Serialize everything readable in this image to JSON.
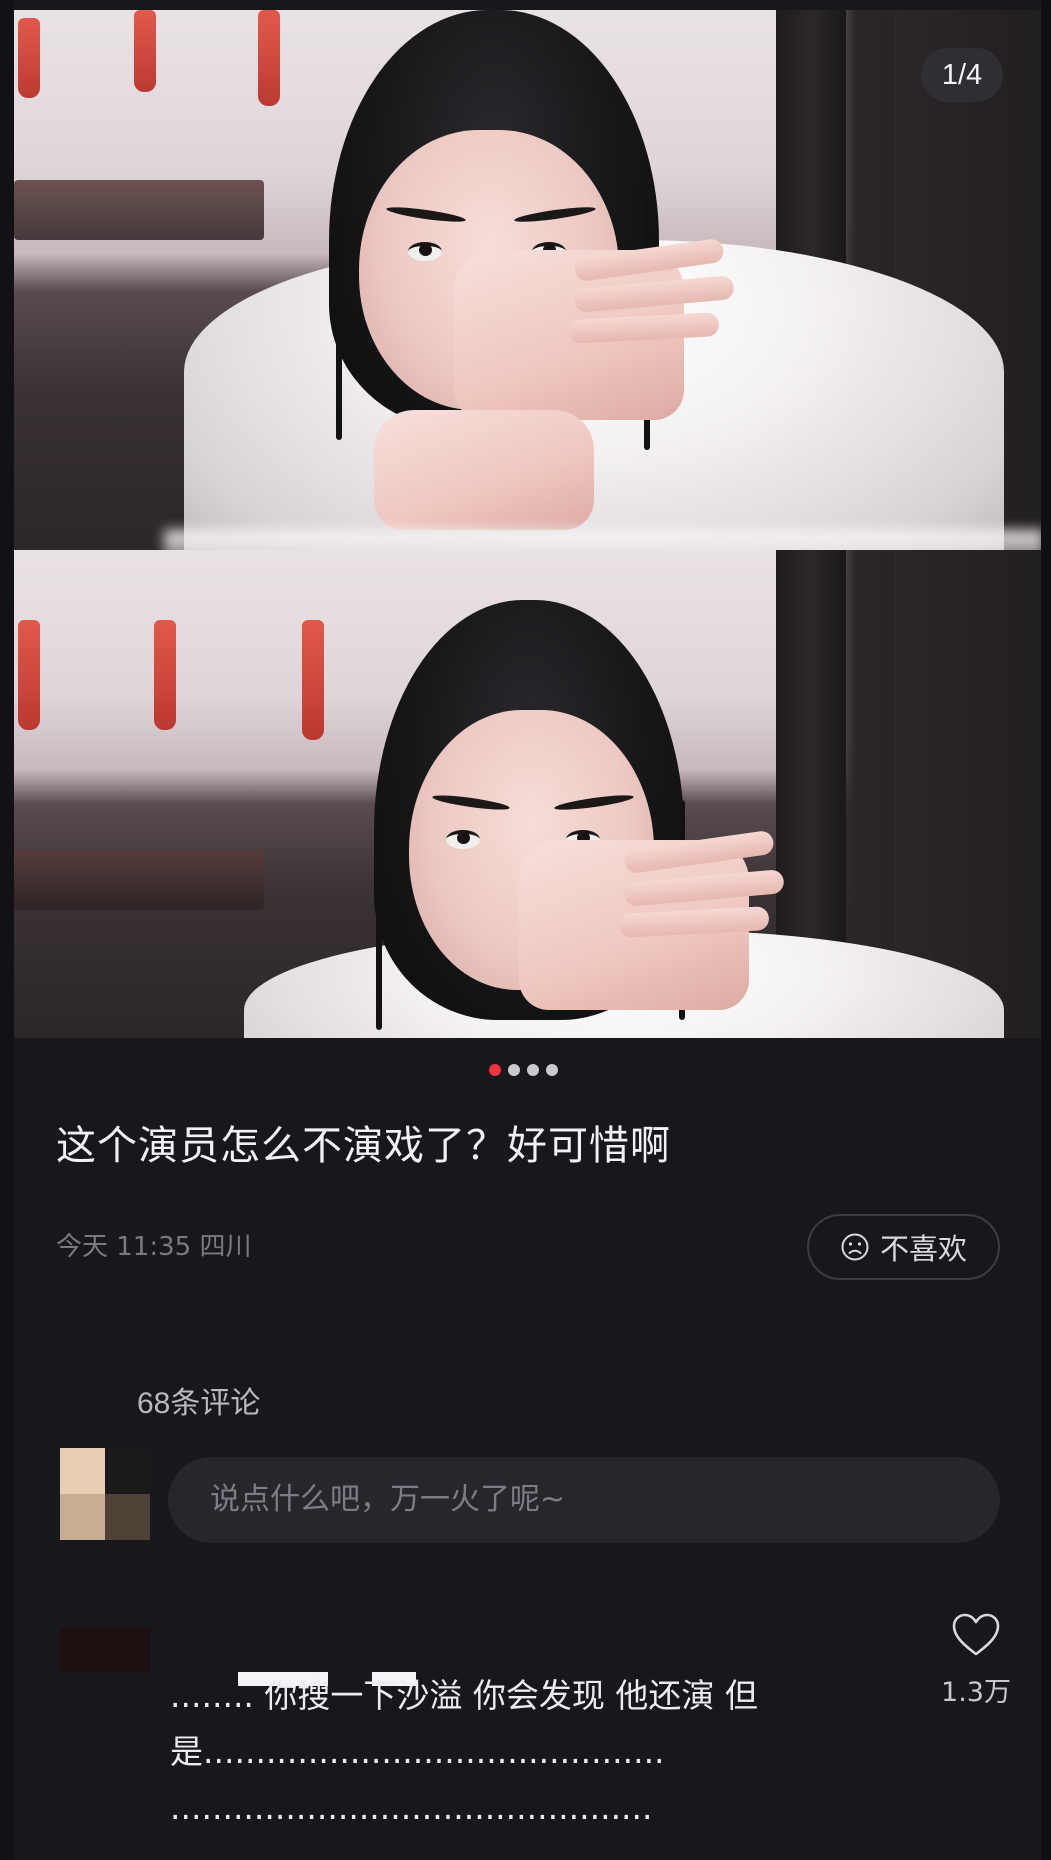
{
  "carousel": {
    "counter": "1/4",
    "dot_count": 4,
    "active_dot": 0
  },
  "post": {
    "title": "这个演员怎么不演戏了？好可惜啊",
    "meta": "今天 11:35 四川",
    "dislike_label": "不喜欢"
  },
  "comments": {
    "count_label": "68条评论",
    "input_placeholder": "说点什么吧，万一火了呢~",
    "items": [
      {
        "text_line1": "........ 你搜一下沙溢 你会发现 他还演 但",
        "text_line2": "是............................................",
        "text_line3": "..............................................",
        "likes": "1.3万"
      }
    ]
  },
  "colors": {
    "background": "#17171c",
    "accent_dot": "#f0313e",
    "input_bg": "#26262c"
  }
}
